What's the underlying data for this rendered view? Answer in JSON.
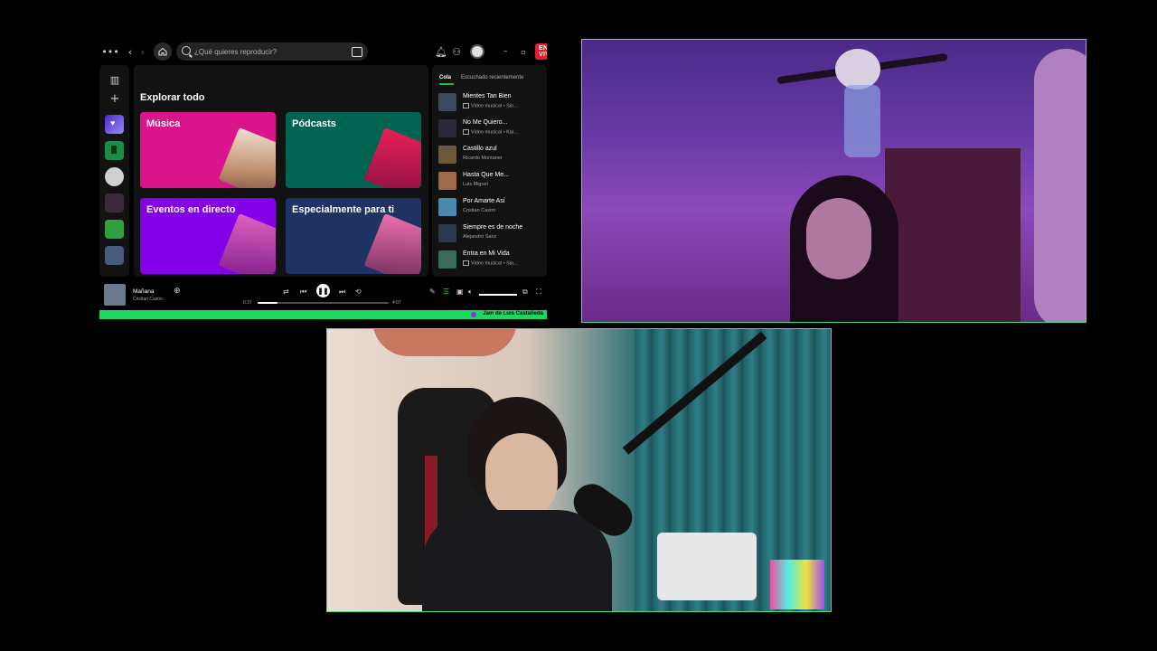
{
  "search": {
    "placeholder": "¿Qué quieres reproducir?"
  },
  "live_badge": "EN VIVO",
  "main": {
    "title": "Explorar todo",
    "cards": [
      {
        "label": "Música",
        "color": "#dc148c"
      },
      {
        "label": "Pódcasts",
        "color": "#006450"
      },
      {
        "label": "Eventos en directo",
        "color": "#8400e7"
      },
      {
        "label": "Especialmente para ti",
        "color": "#1e3264"
      }
    ]
  },
  "queue": {
    "tabs": [
      "Cola",
      "Escuchado recientemente"
    ],
    "items": [
      {
        "title": "Mientes Tan Bien",
        "subtitle": "Video musical • Sin...",
        "video": true,
        "thumb": "#3a4a5a"
      },
      {
        "title": "No Me Quiero...",
        "subtitle": "Video musical • Kal...",
        "video": true,
        "thumb": "#2a2a3a"
      },
      {
        "title": "Castillo azul",
        "subtitle": "Ricardo Montaner",
        "video": false,
        "thumb": "#6a5a3a"
      },
      {
        "title": "Hasta Que Me...",
        "subtitle": "Luis Miguel",
        "video": false,
        "thumb": "#a06a4a"
      },
      {
        "title": "Por Amarte Así",
        "subtitle": "Cristian Castro",
        "video": false,
        "thumb": "#4a8ab0"
      },
      {
        "title": "Siempre es de noche",
        "subtitle": "Alejandro Sanz",
        "video": false,
        "thumb": "#2a3a4a"
      },
      {
        "title": "Entra en Mi Vida",
        "subtitle": "Video musical • Sin...",
        "video": true,
        "thumb": "#3a6a5a"
      }
    ]
  },
  "player": {
    "title": "Mañana",
    "artist": "Cristian Castro",
    "elapsed": "0:37",
    "duration": "4:07",
    "progress": 0.15,
    "volume": 1.0
  },
  "jam": {
    "label": "Jam de Luis Castañeda"
  },
  "colors": {
    "accent": "#1ed760",
    "webcam_border": "#4ade80",
    "live": "#e02030"
  }
}
